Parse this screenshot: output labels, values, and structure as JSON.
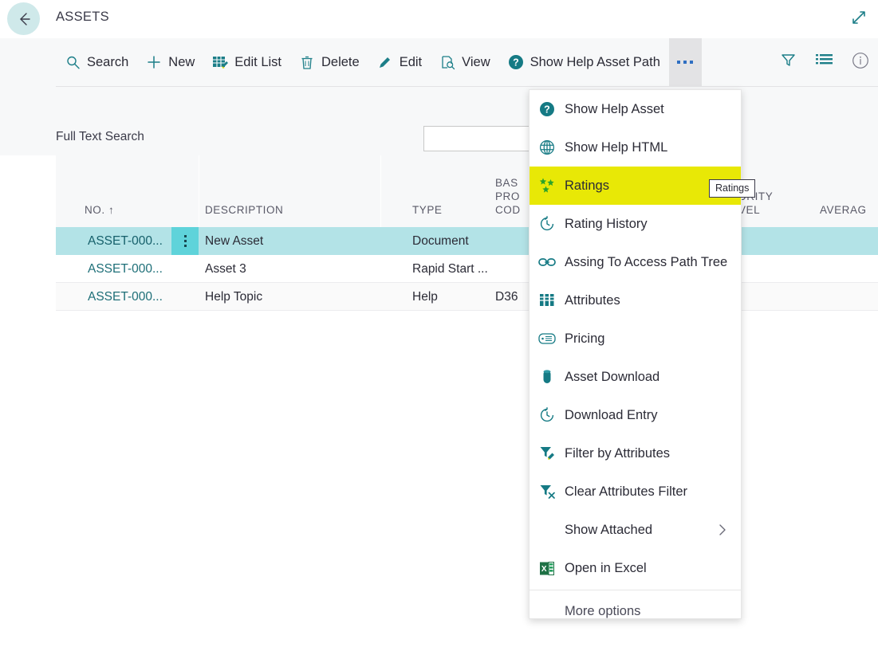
{
  "titlebar": {
    "back_icon": "arrow-left-icon",
    "title": "ASSETS",
    "expand_icon": "expand-diagonal-icon"
  },
  "toolbar": {
    "items": [
      {
        "label": "Search",
        "icon": "search-icon"
      },
      {
        "label": "New",
        "icon": "plus-icon"
      },
      {
        "label": "Edit List",
        "icon": "edit-list-icon"
      },
      {
        "label": "Delete",
        "icon": "trash-icon"
      },
      {
        "label": "Edit",
        "icon": "pencil-icon"
      },
      {
        "label": "View",
        "icon": "view-page-icon"
      },
      {
        "label": "Show Help Asset Path",
        "icon": "help-circle-icon"
      }
    ],
    "overflow_label": "...",
    "right_icons": [
      {
        "name": "filter-funnel-icon"
      },
      {
        "name": "list-view-icon"
      },
      {
        "name": "info-circle-icon"
      }
    ]
  },
  "filter": {
    "full_text_search_label": "Full Text Search",
    "full_text_search_value": "",
    "full_text_search_placeholder": ""
  },
  "grid": {
    "columns": [
      {
        "label": "NO.",
        "sort": "↑"
      },
      {
        "label": "DESCRIPTION"
      },
      {
        "label": "TYPE"
      },
      {
        "label": "BAS\nPRO\nCOD"
      },
      {
        "label": "URITY\nVEL"
      },
      {
        "label": "AVERAG"
      }
    ],
    "rows": [
      {
        "no": "ASSET-000...",
        "description": "New Asset",
        "type": "Document",
        "base_product_code": ""
      },
      {
        "no": "ASSET-000...",
        "description": "Asset 3",
        "type": "Rapid Start ...",
        "base_product_code": ""
      },
      {
        "no": "ASSET-000...",
        "description": "Help Topic",
        "type": "Help",
        "base_product_code": "D36"
      }
    ]
  },
  "menu": {
    "items": [
      {
        "label": "Show Help Asset",
        "icon": "help-circle-icon",
        "highlighted": false
      },
      {
        "label": "Show Help HTML",
        "icon": "globe-icon",
        "highlighted": false
      },
      {
        "label": "Ratings",
        "icon": "stars-rating-icon",
        "highlighted": true
      },
      {
        "label": "Rating History",
        "icon": "clock-history-icon",
        "highlighted": false
      },
      {
        "label": "Assing To Access Path Tree",
        "icon": "link-chain-icon",
        "highlighted": false
      },
      {
        "label": "Attributes",
        "icon": "attributes-grid-icon",
        "highlighted": false
      },
      {
        "label": "Pricing",
        "icon": "pricing-tag-icon",
        "highlighted": false
      },
      {
        "label": "Asset Download",
        "icon": "download-cylinder-icon",
        "highlighted": false
      },
      {
        "label": "Download Entry",
        "icon": "clock-history-icon",
        "highlighted": false
      },
      {
        "label": "Filter by Attributes",
        "icon": "filter-pencil-icon",
        "highlighted": false
      },
      {
        "label": "Clear Attributes Filter",
        "icon": "filter-clear-icon",
        "highlighted": false
      },
      {
        "label": "Show Attached",
        "icon": "none",
        "highlighted": false,
        "submenu_icon": "chevron-right-icon"
      },
      {
        "label": "Open in Excel",
        "icon": "excel-icon",
        "highlighted": false
      }
    ],
    "more_options_label": "More options"
  },
  "tooltip": {
    "text": "Ratings"
  },
  "colors": {
    "accent_teal": "#1c7e88",
    "highlight_yellow": "#e8e806",
    "selected_row": "#b3e3e7",
    "row_handle": "#5fd3da",
    "chrome_gray": "#f7f8f9",
    "excel_green": "#1e7145",
    "rating_green": "#2aa32a"
  }
}
